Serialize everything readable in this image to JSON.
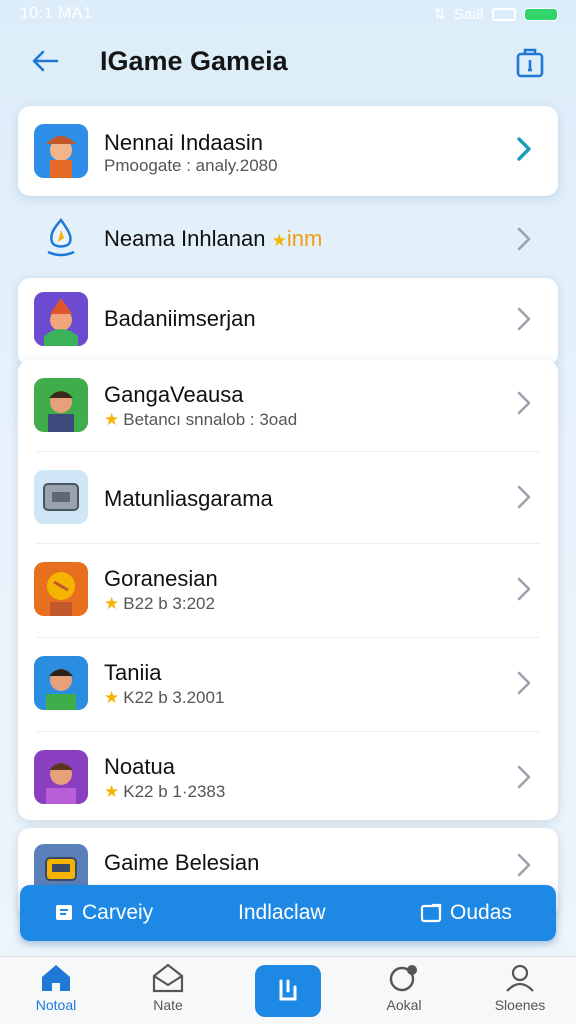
{
  "status_bar": {
    "time": "10:1 MA1",
    "right_text": "Sai8"
  },
  "header": {
    "title": "IGame Gameia"
  },
  "rows": [
    {
      "title": "Nennai Indaasin",
      "subtitle": "Pmoogate : analy.2080"
    },
    {
      "title": "Neama Inhlanan",
      "badge": "inm"
    },
    {
      "title": "Badaniimserjan"
    },
    {
      "title": "GangaVeausa",
      "subtitle": "Betancı snnalob : 3oad"
    },
    {
      "title": "Matunliasgarama"
    },
    {
      "title": "Goranesian",
      "subtitle": "B22 b  3:202"
    },
    {
      "title": "Taniia",
      "subtitle": "K22 b  3.2001"
    },
    {
      "title": "Noatua",
      "subtitle": "K22 b  1·2383"
    },
    {
      "title": "Gaime Belesian"
    }
  ],
  "action_bar": {
    "left": "Carveiy",
    "center": "Indlaclaw",
    "right": "Oudas"
  },
  "bottom_nav": [
    {
      "label": "Notoal"
    },
    {
      "label": "Nate"
    },
    {
      "label": "Aokal"
    },
    {
      "label": "Sloenes"
    }
  ],
  "colors": {
    "accent": "#1e88e5",
    "chevron_active": "#1a9db8",
    "star": "#f4b400"
  }
}
